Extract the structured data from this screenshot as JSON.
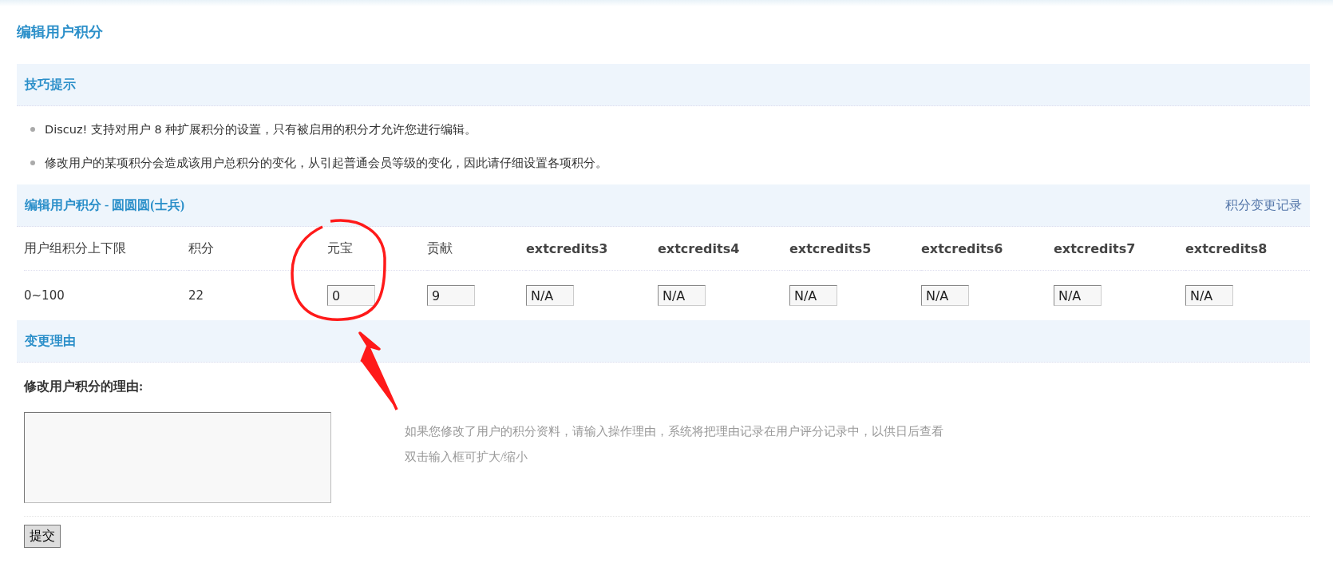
{
  "page_title": "编辑用户积分",
  "tips": {
    "title": "技巧提示",
    "items": [
      "Discuz! 支持对用户 8 种扩展积分的设置，只有被启用的积分才允许您进行编辑。",
      "修改用户的某项积分会造成该用户总积分的变化，从引起普通会员等级的变化，因此请仔细设置各项积分。"
    ]
  },
  "credits": {
    "title": "编辑用户积分 - 圆圆圆(士兵)",
    "link": "积分变更记录",
    "columns": [
      {
        "label": "用户组积分上下限",
        "kind": "text",
        "value": "0~100"
      },
      {
        "label": "积分",
        "kind": "text",
        "value": "22"
      },
      {
        "label": "元宝",
        "kind": "input",
        "value": "0"
      },
      {
        "label": "贡献",
        "kind": "input",
        "value": "9"
      },
      {
        "label": "extcredits3",
        "kind": "input",
        "value": "N/A"
      },
      {
        "label": "extcredits4",
        "kind": "input",
        "value": "N/A"
      },
      {
        "label": "extcredits5",
        "kind": "input",
        "value": "N/A"
      },
      {
        "label": "extcredits6",
        "kind": "input",
        "value": "N/A"
      },
      {
        "label": "extcredits7",
        "kind": "input",
        "value": "N/A"
      },
      {
        "label": "extcredits8",
        "kind": "input",
        "value": "N/A"
      }
    ]
  },
  "reason": {
    "title": "变更理由",
    "label": "修改用户积分的理由:",
    "hints": [
      "如果您修改了用户的积分资料，请输入操作理由，系统将把理由记录在用户评分记录中，以供日后查看",
      "双击输入框可扩大/缩小"
    ]
  },
  "submit": "提交"
}
